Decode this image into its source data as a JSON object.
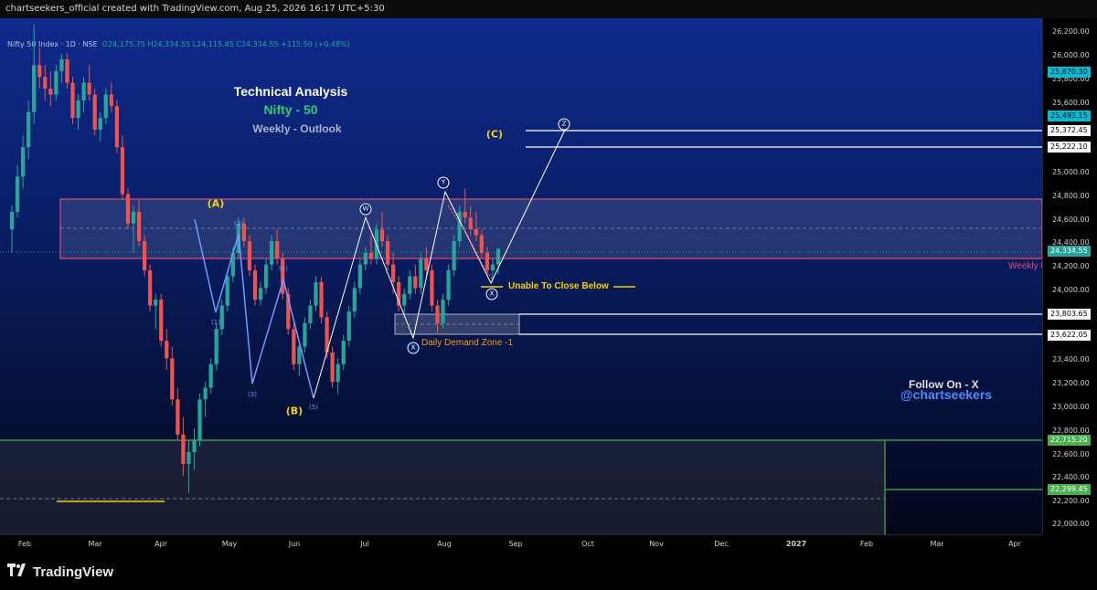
{
  "header": {
    "attribution": "chartseekers_official created with TradingView.com, Aug 25, 2026 16:17 UTC+5:30"
  },
  "legend": {
    "symbol": "Nifty 50 Index · 1D · NSE",
    "ohlc": "O24,175.75 H24,334.55 L24,115.45 C24,334.55 +115.50 (+0.48%)"
  },
  "titles": {
    "line1": "Technical Analysis",
    "line2": "Nifty - 50",
    "line3": "Weekly - Outlook"
  },
  "annotations": {
    "unable": "Unable To Close Below",
    "demand": "Daily Demand Zone -1",
    "weekly": "Weekly F",
    "follow": "Follow On - X",
    "handle": "@chartseekers",
    "C": "(C)",
    "A": "(A)",
    "B": "(B)"
  },
  "wave_labels": {
    "i1": "(1)",
    "i2": "(2)",
    "i3": "(3)",
    "i4": "(4)",
    "i5": "(5)",
    "w": "W",
    "x1": "X",
    "y": "Y",
    "x2": "X",
    "z": "Z"
  },
  "price_axis": [
    "26,200.00",
    "26,000.00",
    "25,800.00",
    "25,600.00",
    "25,000.00",
    "24,800.00",
    "24,600.00",
    "24,400.00",
    "24,200.00",
    "24,000.00",
    "23,400.00",
    "23,200.00",
    "23,000.00",
    "22,800.00",
    "22,600.00",
    "22,400.00",
    "22,200.00",
    "22,000.00"
  ],
  "price_tags": [
    {
      "label": "25,870.30",
      "style": "cyan"
    },
    {
      "label": "25,493.15",
      "style": "cyan"
    },
    {
      "label": "25,372.45",
      "style": "white"
    },
    {
      "label": "25,222.10",
      "style": "white"
    },
    {
      "label": "24,334.55",
      "style": "teal"
    },
    {
      "label": "23,803.65",
      "style": "white"
    },
    {
      "label": "23,622.05",
      "style": "white"
    },
    {
      "label": "22,715.20",
      "style": "green"
    },
    {
      "label": "22,299.45",
      "style": "green"
    }
  ],
  "time_axis": [
    "Feb",
    "Mar",
    "Apr",
    "May",
    "Jun",
    "Jul",
    "Aug",
    "Sep",
    "Oct",
    "Nov",
    "Dec",
    "2027",
    "Feb",
    "Mar",
    "Apr"
  ],
  "footer": {
    "brand": "TradingView"
  },
  "colors": {
    "bull": "#26a69a",
    "bear": "#ef5350",
    "zone": "#e8457a",
    "wave_blue": "#6f9bff",
    "yellow": "#f5d20a",
    "green_line": "#4caf50",
    "orange": "#f39c12",
    "cyan_tag": "#00bcd4"
  },
  "chart_data": {
    "type": "candlestick",
    "ylim": [
      21900,
      26300
    ],
    "x_axis_labels": [
      "Feb",
      "Mar",
      "Apr",
      "May",
      "Jun",
      "Jul",
      "Aug",
      "Sep",
      "Oct",
      "Nov",
      "Dec",
      "2027",
      "Feb",
      "Mar",
      "Apr"
    ],
    "last_close": 24334.55,
    "candles": [
      {
        "o": 24500,
        "h": 24700,
        "l": 24300,
        "c": 24650
      },
      {
        "o": 24650,
        "h": 25050,
        "l": 24600,
        "c": 24950
      },
      {
        "o": 24950,
        "h": 25300,
        "l": 24850,
        "c": 25200
      },
      {
        "o": 25200,
        "h": 25600,
        "l": 25100,
        "c": 25500
      },
      {
        "o": 25500,
        "h": 26250,
        "l": 25400,
        "c": 25900
      },
      {
        "o": 25900,
        "h": 26050,
        "l": 25700,
        "c": 25800
      },
      {
        "o": 25800,
        "h": 25900,
        "l": 25600,
        "c": 25700
      },
      {
        "o": 25700,
        "h": 25850,
        "l": 25550,
        "c": 25650
      },
      {
        "o": 25650,
        "h": 25900,
        "l": 25600,
        "c": 25850
      },
      {
        "o": 25850,
        "h": 26000,
        "l": 25750,
        "c": 25950
      },
      {
        "o": 25950,
        "h": 26000,
        "l": 25700,
        "c": 25750
      },
      {
        "o": 25750,
        "h": 25800,
        "l": 25400,
        "c": 25450
      },
      {
        "o": 25450,
        "h": 25650,
        "l": 25350,
        "c": 25600
      },
      {
        "o": 25600,
        "h": 25800,
        "l": 25500,
        "c": 25750
      },
      {
        "o": 25750,
        "h": 25900,
        "l": 25600,
        "c": 25650
      },
      {
        "o": 25650,
        "h": 25700,
        "l": 25300,
        "c": 25350
      },
      {
        "o": 25350,
        "h": 25500,
        "l": 25250,
        "c": 25450
      },
      {
        "o": 25450,
        "h": 25700,
        "l": 25400,
        "c": 25650
      },
      {
        "o": 25650,
        "h": 25750,
        "l": 25500,
        "c": 25550
      },
      {
        "o": 25550,
        "h": 25600,
        "l": 25150,
        "c": 25200
      },
      {
        "o": 25200,
        "h": 25300,
        "l": 24750,
        "c": 24800
      },
      {
        "o": 24800,
        "h": 24850,
        "l": 24500,
        "c": 24550
      },
      {
        "o": 24550,
        "h": 24700,
        "l": 24300,
        "c": 24650
      },
      {
        "o": 24650,
        "h": 24750,
        "l": 24350,
        "c": 24400
      },
      {
        "o": 24400,
        "h": 24450,
        "l": 24100,
        "c": 24150
      },
      {
        "o": 24150,
        "h": 24200,
        "l": 23800,
        "c": 23850
      },
      {
        "o": 23850,
        "h": 23950,
        "l": 23650,
        "c": 23900
      },
      {
        "o": 23900,
        "h": 23950,
        "l": 23500,
        "c": 23550
      },
      {
        "o": 23550,
        "h": 23650,
        "l": 23300,
        "c": 23400
      },
      {
        "o": 23400,
        "h": 23500,
        "l": 23000,
        "c": 23050
      },
      {
        "o": 23050,
        "h": 23150,
        "l": 22700,
        "c": 22750
      },
      {
        "o": 22750,
        "h": 22900,
        "l": 22400,
        "c": 22500
      },
      {
        "o": 22500,
        "h": 22700,
        "l": 22250,
        "c": 22600
      },
      {
        "o": 22600,
        "h": 22800,
        "l": 22450,
        "c": 22700
      },
      {
        "o": 22700,
        "h": 23100,
        "l": 22650,
        "c": 23050
      },
      {
        "o": 23050,
        "h": 23200,
        "l": 22900,
        "c": 23150
      },
      {
        "o": 23150,
        "h": 23400,
        "l": 23100,
        "c": 23350
      },
      {
        "o": 23350,
        "h": 23700,
        "l": 23300,
        "c": 23650
      },
      {
        "o": 23650,
        "h": 23900,
        "l": 23600,
        "c": 23850
      },
      {
        "o": 23850,
        "h": 24150,
        "l": 23800,
        "c": 24100
      },
      {
        "o": 24100,
        "h": 24350,
        "l": 24050,
        "c": 24300
      },
      {
        "o": 24300,
        "h": 24600,
        "l": 24250,
        "c": 24550
      },
      {
        "o": 24550,
        "h": 24600,
        "l": 24350,
        "c": 24400
      },
      {
        "o": 24400,
        "h": 24450,
        "l": 24100,
        "c": 24150
      },
      {
        "o": 24150,
        "h": 24200,
        "l": 23850,
        "c": 23900
      },
      {
        "o": 23900,
        "h": 24050,
        "l": 23850,
        "c": 24000
      },
      {
        "o": 24000,
        "h": 24250,
        "l": 23950,
        "c": 24200
      },
      {
        "o": 24200,
        "h": 24450,
        "l": 24150,
        "c": 24400
      },
      {
        "o": 24400,
        "h": 24500,
        "l": 24200,
        "c": 24250
      },
      {
        "o": 24250,
        "h": 24300,
        "l": 23900,
        "c": 23950
      },
      {
        "o": 23950,
        "h": 24000,
        "l": 23600,
        "c": 23650
      },
      {
        "o": 23650,
        "h": 23700,
        "l": 23300,
        "c": 23350
      },
      {
        "o": 23350,
        "h": 23550,
        "l": 23250,
        "c": 23500
      },
      {
        "o": 23500,
        "h": 23750,
        "l": 23450,
        "c": 23700
      },
      {
        "o": 23700,
        "h": 23900,
        "l": 23650,
        "c": 23850
      },
      {
        "o": 23850,
        "h": 24100,
        "l": 23800,
        "c": 24050
      },
      {
        "o": 24050,
        "h": 24100,
        "l": 23700,
        "c": 23750
      },
      {
        "o": 23750,
        "h": 23800,
        "l": 23400,
        "c": 23450
      },
      {
        "o": 23450,
        "h": 23500,
        "l": 23150,
        "c": 23200
      },
      {
        "o": 23200,
        "h": 23400,
        "l": 23100,
        "c": 23350
      },
      {
        "o": 23350,
        "h": 23600,
        "l": 23300,
        "c": 23550
      },
      {
        "o": 23550,
        "h": 23850,
        "l": 23500,
        "c": 23800
      },
      {
        "o": 23800,
        "h": 24050,
        "l": 23750,
        "c": 24000
      },
      {
        "o": 24000,
        "h": 24250,
        "l": 23950,
        "c": 24200
      },
      {
        "o": 24200,
        "h": 24350,
        "l": 24150,
        "c": 24300
      },
      {
        "o": 24300,
        "h": 24450,
        "l": 24200,
        "c": 24250
      },
      {
        "o": 24250,
        "h": 24550,
        "l": 24200,
        "c": 24500
      },
      {
        "o": 24500,
        "h": 24650,
        "l": 24350,
        "c": 24400
      },
      {
        "o": 24400,
        "h": 24450,
        "l": 24150,
        "c": 24200
      },
      {
        "o": 24200,
        "h": 24300,
        "l": 23950,
        "c": 24050
      },
      {
        "o": 24050,
        "h": 24100,
        "l": 23800,
        "c": 23850
      },
      {
        "o": 23850,
        "h": 24000,
        "l": 23750,
        "c": 23950
      },
      {
        "o": 23950,
        "h": 24150,
        "l": 23900,
        "c": 24100
      },
      {
        "o": 24100,
        "h": 24200,
        "l": 23950,
        "c": 24000
      },
      {
        "o": 24000,
        "h": 24300,
        "l": 23950,
        "c": 24250
      },
      {
        "o": 24250,
        "h": 24350,
        "l": 24100,
        "c": 24150
      },
      {
        "o": 24150,
        "h": 24200,
        "l": 23800,
        "c": 23850
      },
      {
        "o": 23850,
        "h": 23900,
        "l": 23600,
        "c": 23700
      },
      {
        "o": 23700,
        "h": 23950,
        "l": 23650,
        "c": 23900
      },
      {
        "o": 23900,
        "h": 24200,
        "l": 23850,
        "c": 24150
      },
      {
        "o": 24150,
        "h": 24450,
        "l": 24100,
        "c": 24400
      },
      {
        "o": 24400,
        "h": 24700,
        "l": 24350,
        "c": 24650
      },
      {
        "o": 24650,
        "h": 24850,
        "l": 24550,
        "c": 24600
      },
      {
        "o": 24600,
        "h": 24700,
        "l": 24450,
        "c": 24500
      },
      {
        "o": 24500,
        "h": 24650,
        "l": 24400,
        "c": 24450
      },
      {
        "o": 24450,
        "h": 24500,
        "l": 24250,
        "c": 24300
      },
      {
        "o": 24300,
        "h": 24350,
        "l": 24100,
        "c": 24150
      },
      {
        "o": 24150,
        "h": 24250,
        "l": 24050,
        "c": 24200
      },
      {
        "o": 24200,
        "h": 24340,
        "l": 24115,
        "c": 24334
      }
    ]
  }
}
